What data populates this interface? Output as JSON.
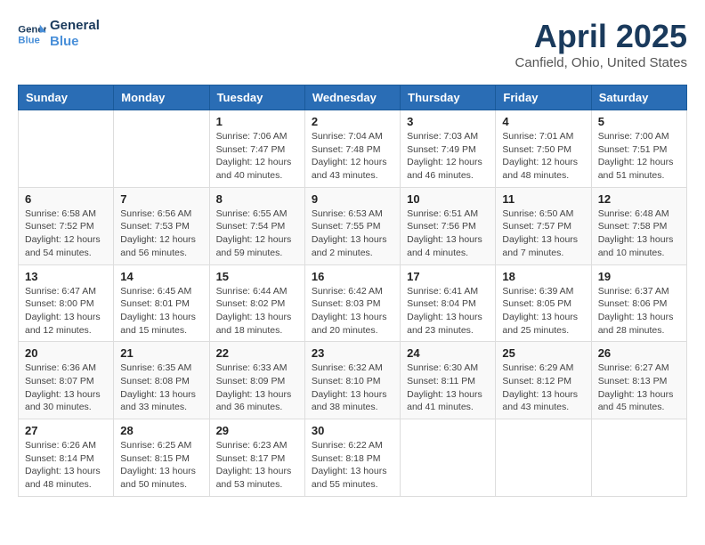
{
  "header": {
    "logo_line1": "General",
    "logo_line2": "Blue",
    "month_title": "April 2025",
    "location": "Canfield, Ohio, United States"
  },
  "weekdays": [
    "Sunday",
    "Monday",
    "Tuesday",
    "Wednesday",
    "Thursday",
    "Friday",
    "Saturday"
  ],
  "weeks": [
    [
      {
        "day": "",
        "info": ""
      },
      {
        "day": "",
        "info": ""
      },
      {
        "day": "1",
        "info": "Sunrise: 7:06 AM\nSunset: 7:47 PM\nDaylight: 12 hours and 40 minutes."
      },
      {
        "day": "2",
        "info": "Sunrise: 7:04 AM\nSunset: 7:48 PM\nDaylight: 12 hours and 43 minutes."
      },
      {
        "day": "3",
        "info": "Sunrise: 7:03 AM\nSunset: 7:49 PM\nDaylight: 12 hours and 46 minutes."
      },
      {
        "day": "4",
        "info": "Sunrise: 7:01 AM\nSunset: 7:50 PM\nDaylight: 12 hours and 48 minutes."
      },
      {
        "day": "5",
        "info": "Sunrise: 7:00 AM\nSunset: 7:51 PM\nDaylight: 12 hours and 51 minutes."
      }
    ],
    [
      {
        "day": "6",
        "info": "Sunrise: 6:58 AM\nSunset: 7:52 PM\nDaylight: 12 hours and 54 minutes."
      },
      {
        "day": "7",
        "info": "Sunrise: 6:56 AM\nSunset: 7:53 PM\nDaylight: 12 hours and 56 minutes."
      },
      {
        "day": "8",
        "info": "Sunrise: 6:55 AM\nSunset: 7:54 PM\nDaylight: 12 hours and 59 minutes."
      },
      {
        "day": "9",
        "info": "Sunrise: 6:53 AM\nSunset: 7:55 PM\nDaylight: 13 hours and 2 minutes."
      },
      {
        "day": "10",
        "info": "Sunrise: 6:51 AM\nSunset: 7:56 PM\nDaylight: 13 hours and 4 minutes."
      },
      {
        "day": "11",
        "info": "Sunrise: 6:50 AM\nSunset: 7:57 PM\nDaylight: 13 hours and 7 minutes."
      },
      {
        "day": "12",
        "info": "Sunrise: 6:48 AM\nSunset: 7:58 PM\nDaylight: 13 hours and 10 minutes."
      }
    ],
    [
      {
        "day": "13",
        "info": "Sunrise: 6:47 AM\nSunset: 8:00 PM\nDaylight: 13 hours and 12 minutes."
      },
      {
        "day": "14",
        "info": "Sunrise: 6:45 AM\nSunset: 8:01 PM\nDaylight: 13 hours and 15 minutes."
      },
      {
        "day": "15",
        "info": "Sunrise: 6:44 AM\nSunset: 8:02 PM\nDaylight: 13 hours and 18 minutes."
      },
      {
        "day": "16",
        "info": "Sunrise: 6:42 AM\nSunset: 8:03 PM\nDaylight: 13 hours and 20 minutes."
      },
      {
        "day": "17",
        "info": "Sunrise: 6:41 AM\nSunset: 8:04 PM\nDaylight: 13 hours and 23 minutes."
      },
      {
        "day": "18",
        "info": "Sunrise: 6:39 AM\nSunset: 8:05 PM\nDaylight: 13 hours and 25 minutes."
      },
      {
        "day": "19",
        "info": "Sunrise: 6:37 AM\nSunset: 8:06 PM\nDaylight: 13 hours and 28 minutes."
      }
    ],
    [
      {
        "day": "20",
        "info": "Sunrise: 6:36 AM\nSunset: 8:07 PM\nDaylight: 13 hours and 30 minutes."
      },
      {
        "day": "21",
        "info": "Sunrise: 6:35 AM\nSunset: 8:08 PM\nDaylight: 13 hours and 33 minutes."
      },
      {
        "day": "22",
        "info": "Sunrise: 6:33 AM\nSunset: 8:09 PM\nDaylight: 13 hours and 36 minutes."
      },
      {
        "day": "23",
        "info": "Sunrise: 6:32 AM\nSunset: 8:10 PM\nDaylight: 13 hours and 38 minutes."
      },
      {
        "day": "24",
        "info": "Sunrise: 6:30 AM\nSunset: 8:11 PM\nDaylight: 13 hours and 41 minutes."
      },
      {
        "day": "25",
        "info": "Sunrise: 6:29 AM\nSunset: 8:12 PM\nDaylight: 13 hours and 43 minutes."
      },
      {
        "day": "26",
        "info": "Sunrise: 6:27 AM\nSunset: 8:13 PM\nDaylight: 13 hours and 45 minutes."
      }
    ],
    [
      {
        "day": "27",
        "info": "Sunrise: 6:26 AM\nSunset: 8:14 PM\nDaylight: 13 hours and 48 minutes."
      },
      {
        "day": "28",
        "info": "Sunrise: 6:25 AM\nSunset: 8:15 PM\nDaylight: 13 hours and 50 minutes."
      },
      {
        "day": "29",
        "info": "Sunrise: 6:23 AM\nSunset: 8:17 PM\nDaylight: 13 hours and 53 minutes."
      },
      {
        "day": "30",
        "info": "Sunrise: 6:22 AM\nSunset: 8:18 PM\nDaylight: 13 hours and 55 minutes."
      },
      {
        "day": "",
        "info": ""
      },
      {
        "day": "",
        "info": ""
      },
      {
        "day": "",
        "info": ""
      }
    ]
  ]
}
